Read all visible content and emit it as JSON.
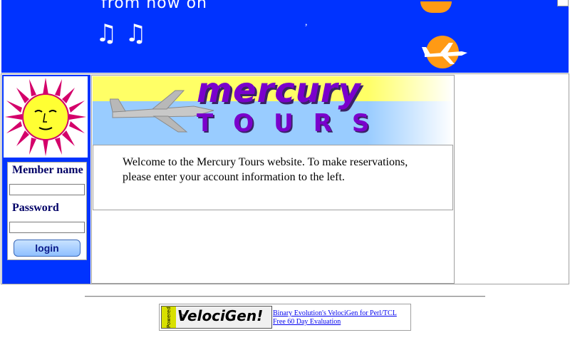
{
  "banner": {
    "text": "from now on",
    "notes": "♫ ♫",
    "tick": ",",
    "colors": {
      "background": "#0033ff",
      "sun": "#ff9a14"
    }
  },
  "sidebar": {
    "member_label": "Member name",
    "password_label": "Password",
    "login_button": "login",
    "member_value": "",
    "password_value": ""
  },
  "header": {
    "brand_top": "mercury",
    "brand_bottom": "TOURS"
  },
  "welcome": {
    "text": "Welcome to the Mercury Tours website. To make reservations, please enter your account information to the left."
  },
  "footer": {
    "powered_by": "Powered By",
    "velocigen_brand": "VelociGen!",
    "link1": "Binary Evolution's VelociGen for Perl/TCL",
    "link2": "Free 60 Day Evaluation"
  },
  "colors": {
    "brand_purple": "#7a00cc",
    "header_yellow": "#ffff66",
    "header_blue": "#99ccff",
    "sidebar_blue": "#0033ff"
  }
}
